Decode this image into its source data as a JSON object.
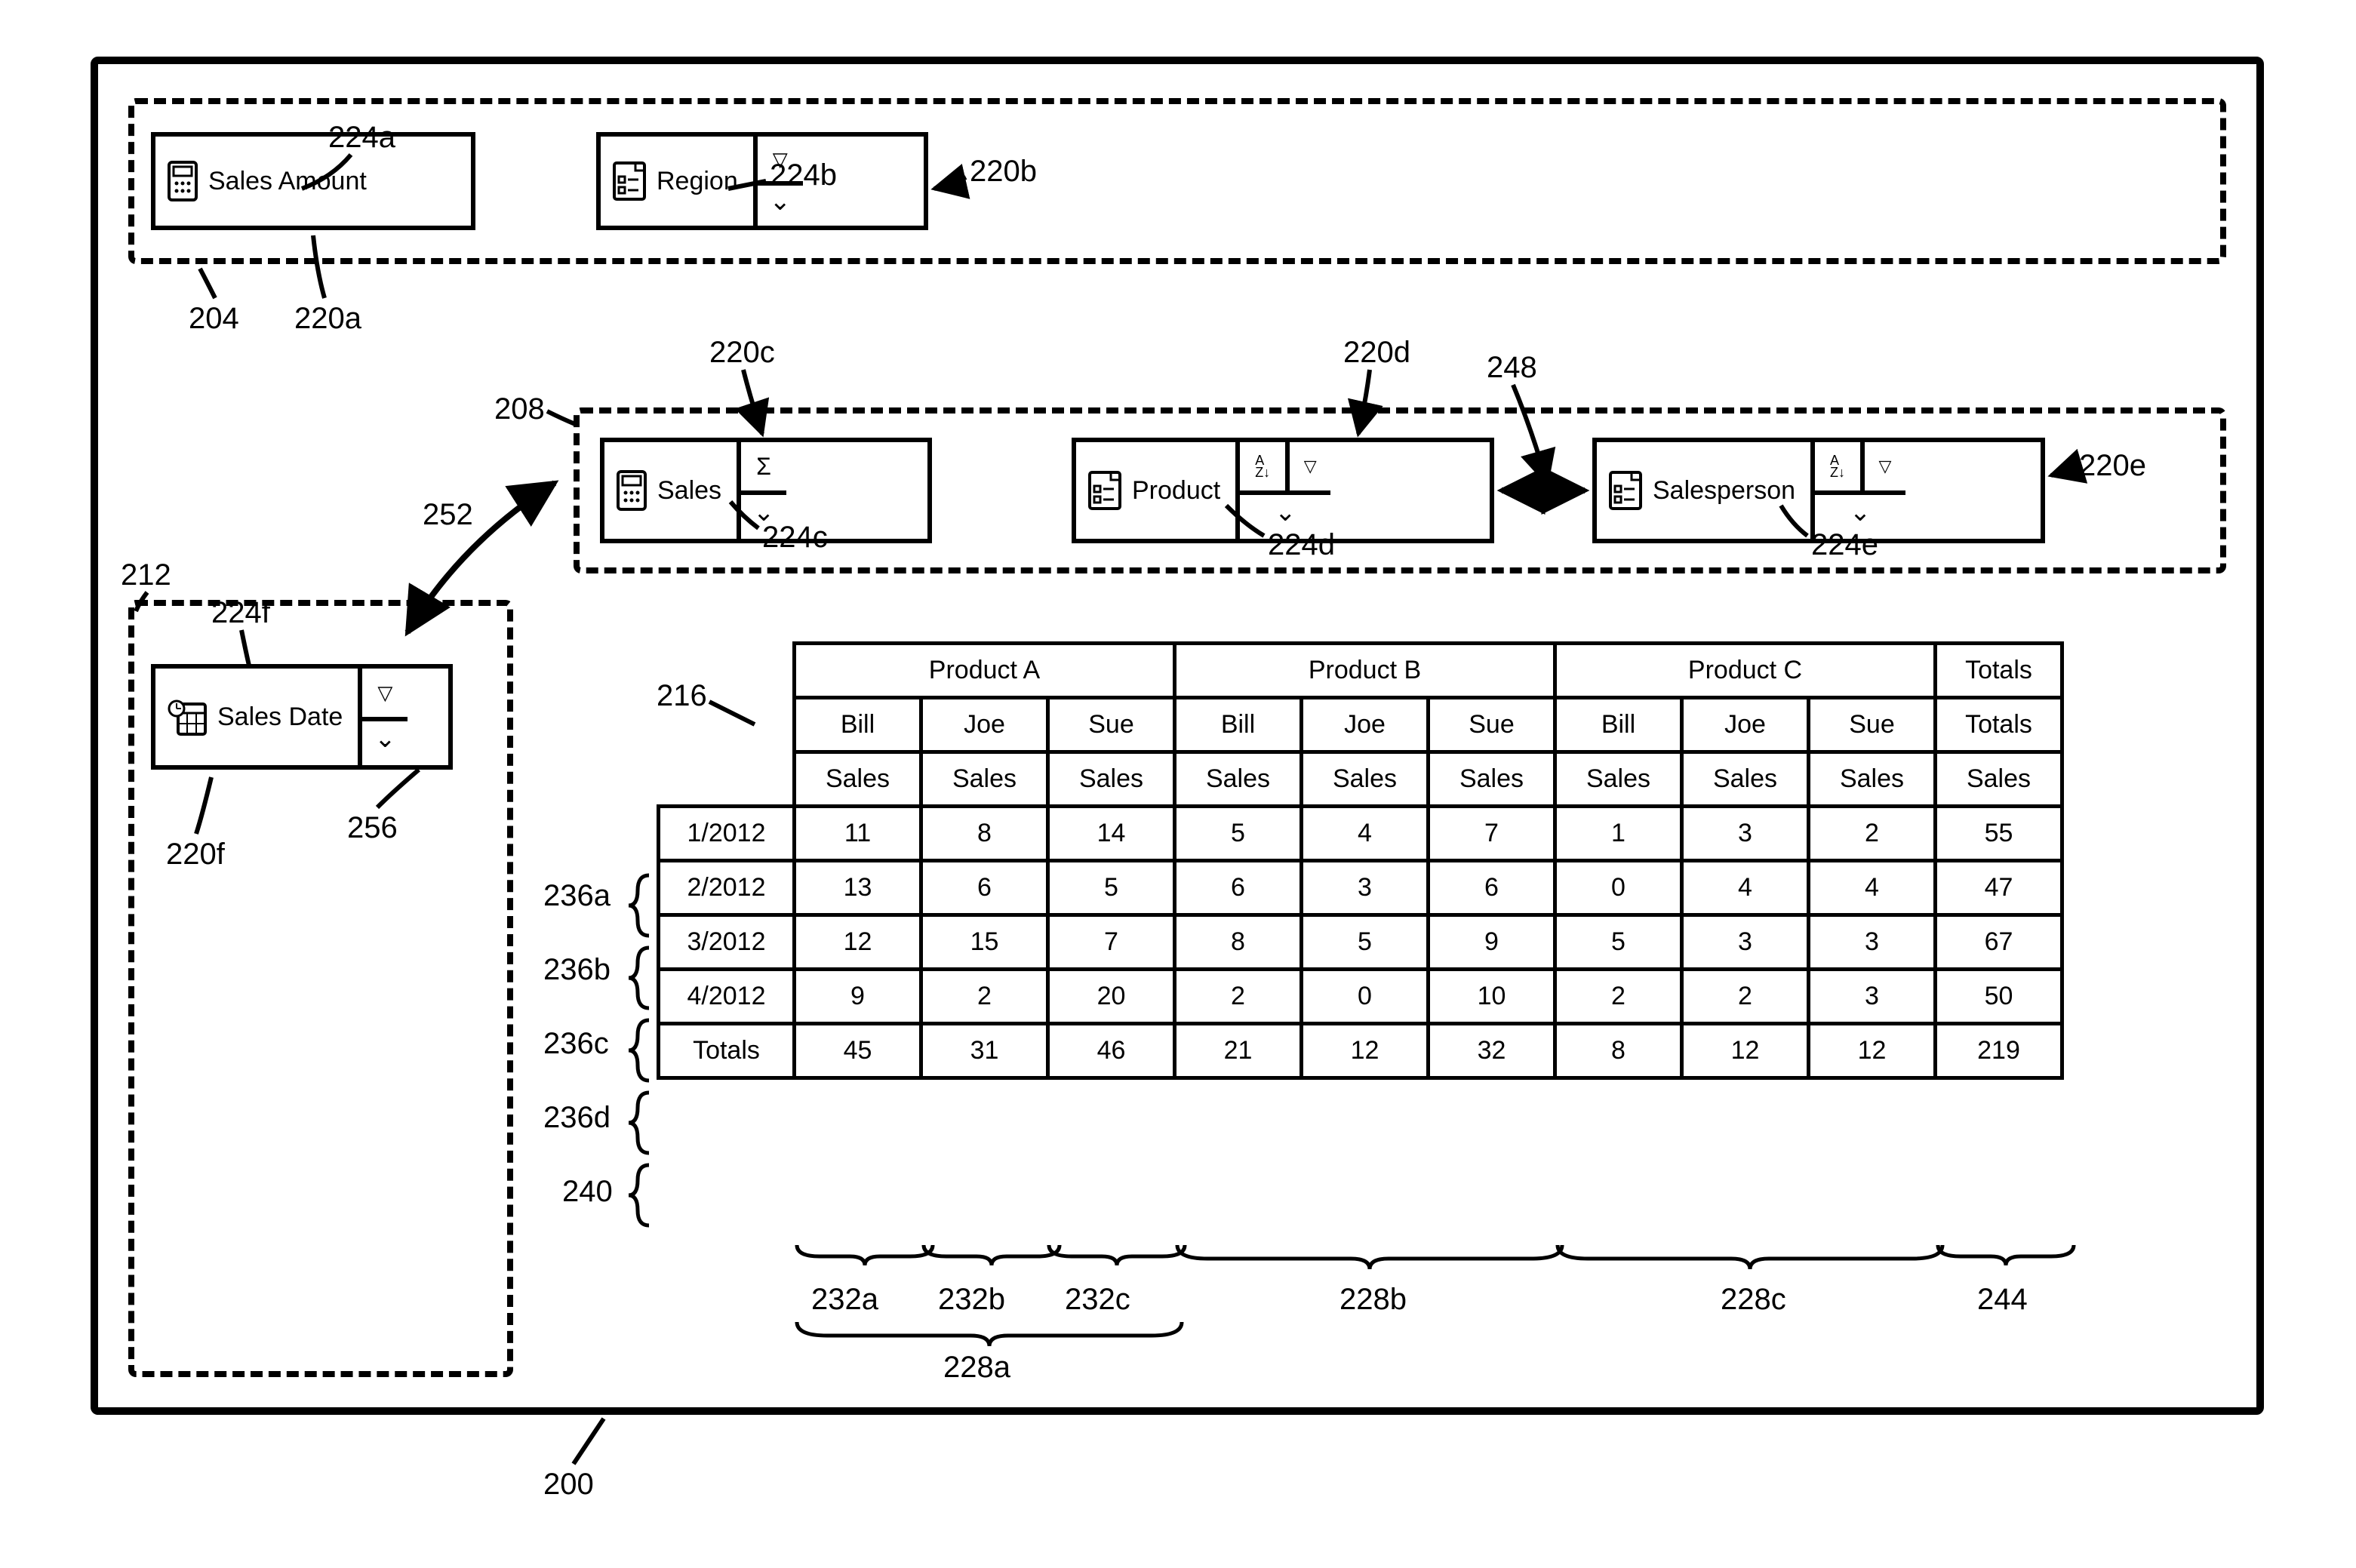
{
  "callouts": {
    "c200": "200",
    "c204": "204",
    "c208": "208",
    "c212": "212",
    "c216": "216",
    "c220a": "220a",
    "c220b": "220b",
    "c220c": "220c",
    "c220d": "220d",
    "c220e": "220e",
    "c220f": "220f",
    "c224a": "224a",
    "c224b": "224b",
    "c224c": "224c",
    "c224d": "224d",
    "c224e": "224e",
    "c224f": "224f",
    "c228a": "228a",
    "c228b": "228b",
    "c228c": "228c",
    "c232a": "232a",
    "c232b": "232b",
    "c232c": "232c",
    "c236a": "236a",
    "c236b": "236b",
    "c236c": "236c",
    "c236d": "236d",
    "c240": "240",
    "c244": "244",
    "c248": "248",
    "c252": "252",
    "c256": "256"
  },
  "tokens": {
    "salesAmount": {
      "label": "Sales Amount"
    },
    "region": {
      "label": "Region"
    },
    "sales": {
      "label": "Sales"
    },
    "product": {
      "label": "Product"
    },
    "salesperson": {
      "label": "Salesperson"
    },
    "salesDate": {
      "label": "Sales Date"
    }
  },
  "glyphs": {
    "filter": "▽",
    "dropdown": "⌄",
    "chevron_down": "⌄",
    "sigma": "Σ",
    "sort_az": "A\nZ↓"
  },
  "table": {
    "col_groups": [
      "Product A",
      "Product B",
      "Product C"
    ],
    "salespeople": [
      "Bill",
      "Joe",
      "Sue"
    ],
    "metric": "Sales",
    "totals_label": "Totals",
    "row_headers": [
      "1/2012",
      "2/2012",
      "3/2012",
      "4/2012",
      "Totals"
    ],
    "cells": [
      [
        11,
        8,
        14,
        5,
        4,
        7,
        1,
        3,
        2,
        55
      ],
      [
        13,
        6,
        5,
        6,
        3,
        6,
        0,
        4,
        4,
        47
      ],
      [
        12,
        15,
        7,
        8,
        5,
        9,
        5,
        3,
        3,
        67
      ],
      [
        9,
        2,
        20,
        2,
        0,
        10,
        2,
        2,
        3,
        50
      ],
      [
        45,
        31,
        46,
        21,
        12,
        32,
        8,
        12,
        12,
        219
      ]
    ]
  },
  "chart_data": {
    "type": "table",
    "title": "",
    "column_hierarchy": {
      "level1": [
        "Product A",
        "Product B",
        "Product C",
        "Totals"
      ],
      "level2_under_products": [
        "Bill",
        "Joe",
        "Sue"
      ],
      "level3_metric": "Sales"
    },
    "rows": [
      "1/2012",
      "2/2012",
      "3/2012",
      "4/2012",
      "Totals"
    ],
    "data_by_row": {
      "1/2012": {
        "Product A": {
          "Bill": 11,
          "Joe": 8,
          "Sue": 14
        },
        "Product B": {
          "Bill": 5,
          "Joe": 4,
          "Sue": 7
        },
        "Product C": {
          "Bill": 1,
          "Joe": 3,
          "Sue": 2
        },
        "Totals": 55
      },
      "2/2012": {
        "Product A": {
          "Bill": 13,
          "Joe": 6,
          "Sue": 5
        },
        "Product B": {
          "Bill": 6,
          "Joe": 3,
          "Sue": 6
        },
        "Product C": {
          "Bill": 0,
          "Joe": 4,
          "Sue": 4
        },
        "Totals": 47
      },
      "3/2012": {
        "Product A": {
          "Bill": 12,
          "Joe": 15,
          "Sue": 7
        },
        "Product B": {
          "Bill": 8,
          "Joe": 5,
          "Sue": 9
        },
        "Product C": {
          "Bill": 5,
          "Joe": 3,
          "Sue": 3
        },
        "Totals": 67
      },
      "4/2012": {
        "Product A": {
          "Bill": 9,
          "Joe": 2,
          "Sue": 20
        },
        "Product B": {
          "Bill": 2,
          "Joe": 0,
          "Sue": 10
        },
        "Product C": {
          "Bill": 2,
          "Joe": 2,
          "Sue": 3
        },
        "Totals": 50
      },
      "Totals": {
        "Product A": {
          "Bill": 45,
          "Joe": 31,
          "Sue": 46
        },
        "Product B": {
          "Bill": 21,
          "Joe": 12,
          "Sue": 32
        },
        "Product C": {
          "Bill": 8,
          "Joe": 12,
          "Sue": 12
        },
        "Totals": 219
      }
    }
  }
}
